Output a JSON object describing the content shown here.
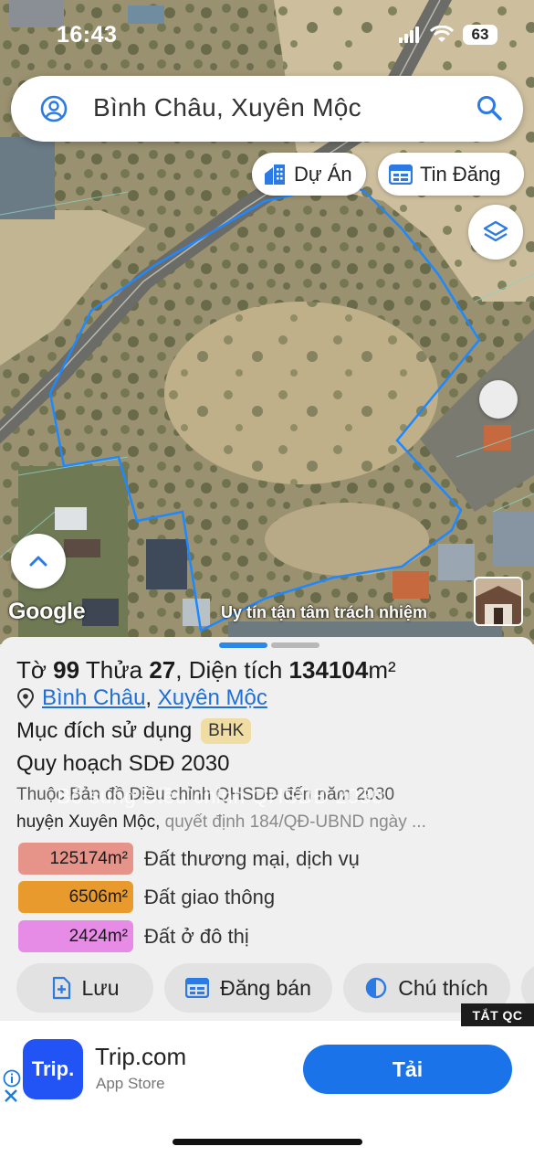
{
  "status_bar": {
    "time": "16:43",
    "battery": "63"
  },
  "search": {
    "query": "Bình Châu, Xuyên Mộc"
  },
  "chips": {
    "du_an": "Dự Án",
    "tin_dang": "Tin Đăng"
  },
  "map": {
    "provider_logo": "Google",
    "watermark": "Uy tín tận tâm trách nhiệm",
    "parcel_outline_color": "#1e88ff"
  },
  "parcel": {
    "to_label": "Tờ",
    "to_value": "99",
    "thua_label": "Thửa",
    "thua_value": "27",
    "area_label": "Diện tích",
    "area_value": "134104",
    "area_unit": "m²",
    "commune": "Bình Châu",
    "district": "Xuyên Mộc",
    "separator": ",",
    "usage_label": "Mục đích sử dụng",
    "usage_code": "BHK",
    "plan_title": "Quy hoạch SDĐ 2030",
    "plan_source_line1": "Thuộc Bản đồ Điều chỉnh QHSDĐ đến năm 2030",
    "plan_source_overlay": "Bổ sung Điều chỉnh QHSDĐ 2030",
    "plan_source_line2": "huyện Xuyên Mộc,",
    "plan_source_line2_muted": " quyết định 184/QĐ-UBND ngày ..."
  },
  "zones": [
    {
      "area": "125174m²",
      "label": "Đất thương mại, dịch vụ",
      "color": "#e6948a"
    },
    {
      "area": "6506m²",
      "label": "Đất giao thông",
      "color": "#e99a2c"
    },
    {
      "area": "2424m²",
      "label": "Đất ở đô thị",
      "color": "#e68be6"
    }
  ],
  "actions": {
    "save": "Lưu",
    "sell": "Đăng bán",
    "legend": "Chú thích"
  },
  "ad": {
    "close_label": "TẮT QC",
    "logo_text": "Trip.",
    "title": "Trip.com",
    "subtitle": "App Store",
    "cta": "Tải"
  }
}
